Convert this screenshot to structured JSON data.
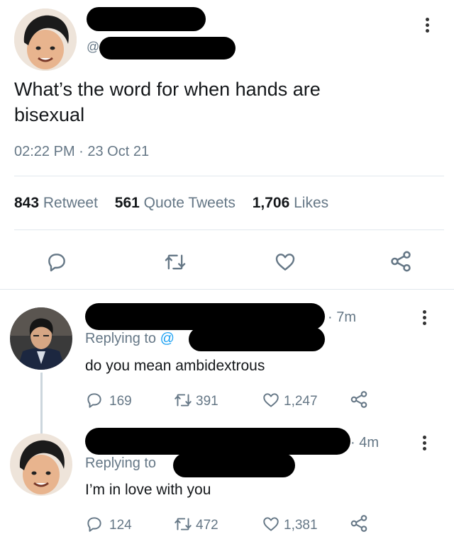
{
  "main_tweet": {
    "handle_prefix": "@",
    "text": "What’s the word for when hands are bisexual",
    "timestamp": "02:22 PM · 23 Oct 21",
    "stats": {
      "retweets_count": "843",
      "retweets_label": "Retweet",
      "quotes_count": "561",
      "quotes_label": "Quote Tweets",
      "likes_count": "1,706",
      "likes_label": "Likes"
    }
  },
  "replies": [
    {
      "time": "· 7m",
      "replying_label": "Replying to",
      "replying_handle_prefix": "@",
      "text": "do you mean ambidextrous",
      "reply_count": "169",
      "retweet_count": "391",
      "like_count": "1,247"
    },
    {
      "time": "· 4m",
      "replying_label": "Replying to",
      "text": "I’m in love with you",
      "reply_count": "124",
      "retweet_count": "472",
      "like_count": "1,381"
    }
  ],
  "colors": {
    "accent": "#1da1f2",
    "text": "#14171a",
    "secondary": "#657786",
    "divider": "#e1e8ed",
    "icon": "#657786"
  },
  "icons": [
    "reply-icon",
    "retweet-icon",
    "like-icon",
    "share-icon",
    "more-icon"
  ]
}
